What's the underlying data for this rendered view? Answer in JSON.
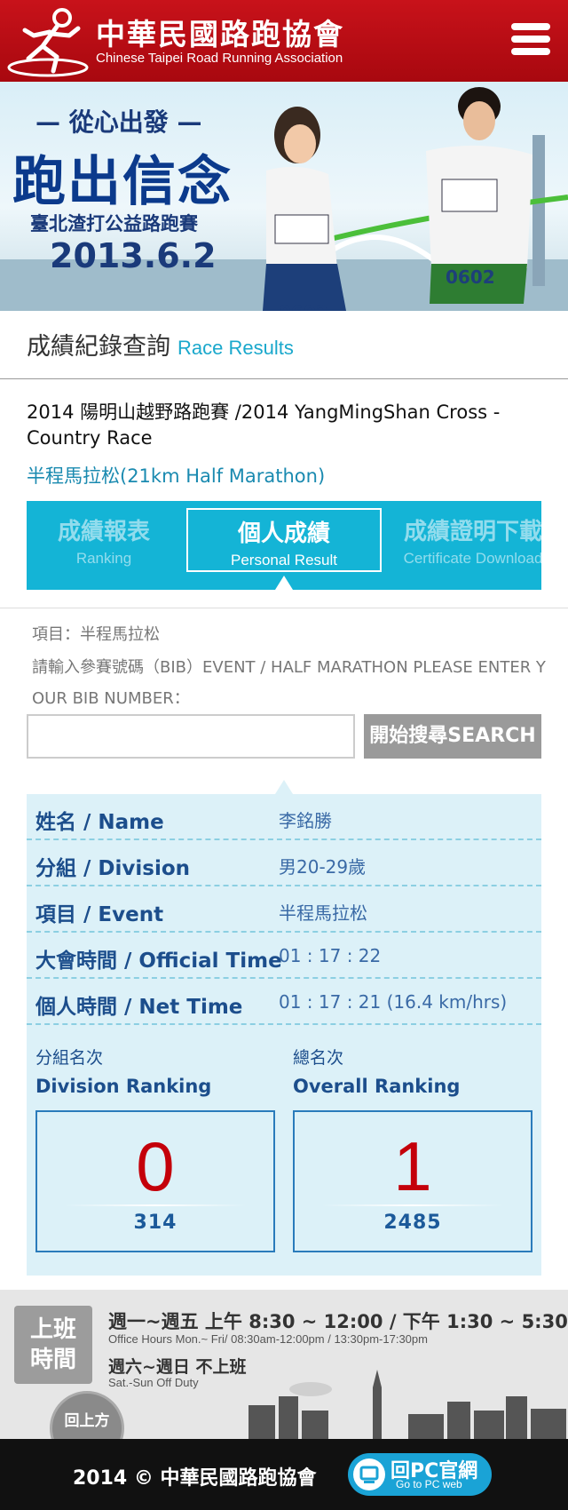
{
  "header": {
    "title": "中華民國路跑協會",
    "subtitle": "Chinese Taipei Road Running Association"
  },
  "banner": {
    "line1": "— 從心出發 —",
    "line2": "跑出信念",
    "line3": "臺北渣打公益路跑賽",
    "line4": "2013.6.2",
    "bib_left": "0602",
    "bib_right": "0602"
  },
  "page": {
    "title_zh": "成績紀錄查詢",
    "title_en": "Race Results"
  },
  "race": {
    "name": "2014 陽明山越野路跑賽 /2014 YangMingShan Cross -Country Race",
    "category": "半程馬拉松(21km Half Marathon)"
  },
  "tabs": [
    {
      "zh": "成績報表",
      "en": "Ranking"
    },
    {
      "zh": "個人成績",
      "en": "Personal Result"
    },
    {
      "zh": "成績證明下載",
      "en": "Certificate Download"
    }
  ],
  "form": {
    "item": "項目：半程馬拉松",
    "prompt": "請輸入參賽號碼（BIB）EVENT / HALF MARATHON  PLEASE ENTER YOUR BIB NUMBER：",
    "input_value": "",
    "search_label": "開始搜尋SEARCH"
  },
  "result": {
    "rows": [
      {
        "label": "姓名 / Name",
        "value": "李銘勝"
      },
      {
        "label": "分組 / Division",
        "value": "男20-29歲"
      },
      {
        "label": "項目 / Event",
        "value": "半程馬拉松"
      },
      {
        "label": "大會時間 / Official Time",
        "value": "01 : 17 : 22"
      },
      {
        "label": "個人時間 / Net Time",
        "value": "01 : 17 : 21 (16.4 km/hrs)"
      }
    ],
    "division_ranking": {
      "zh": "分組名次",
      "en": "Division Ranking",
      "rank": "0",
      "total": "314"
    },
    "overall_ranking": {
      "zh": "總名次",
      "en": "Overall Ranking",
      "rank": "1",
      "total": "2485"
    }
  },
  "footer": {
    "hours_badge_1": "上班",
    "hours_badge_2": "時間",
    "weekday": "週一~週五 上午 8:30 ~ 12:00 / 下午 1:30 ~ 5:30",
    "weekday_en": "Office Hours  Mon.~ Fri/ 08:30am-12:00pm / 13:30pm-17:30pm",
    "weekend": "週六~週日 不上班",
    "weekend_en": "Sat.-Sun Off Duty",
    "back_to_top": "回上方",
    "copyright": "2014 © 中華民國路跑協會",
    "pc_zh": "回PC官網",
    "pc_en": "Go to PC web"
  },
  "colors": {
    "header_red": "#b30d15",
    "tab_blue": "#14b4d6",
    "result_bg": "#dcf1f8",
    "rank_red": "#c4000a"
  }
}
